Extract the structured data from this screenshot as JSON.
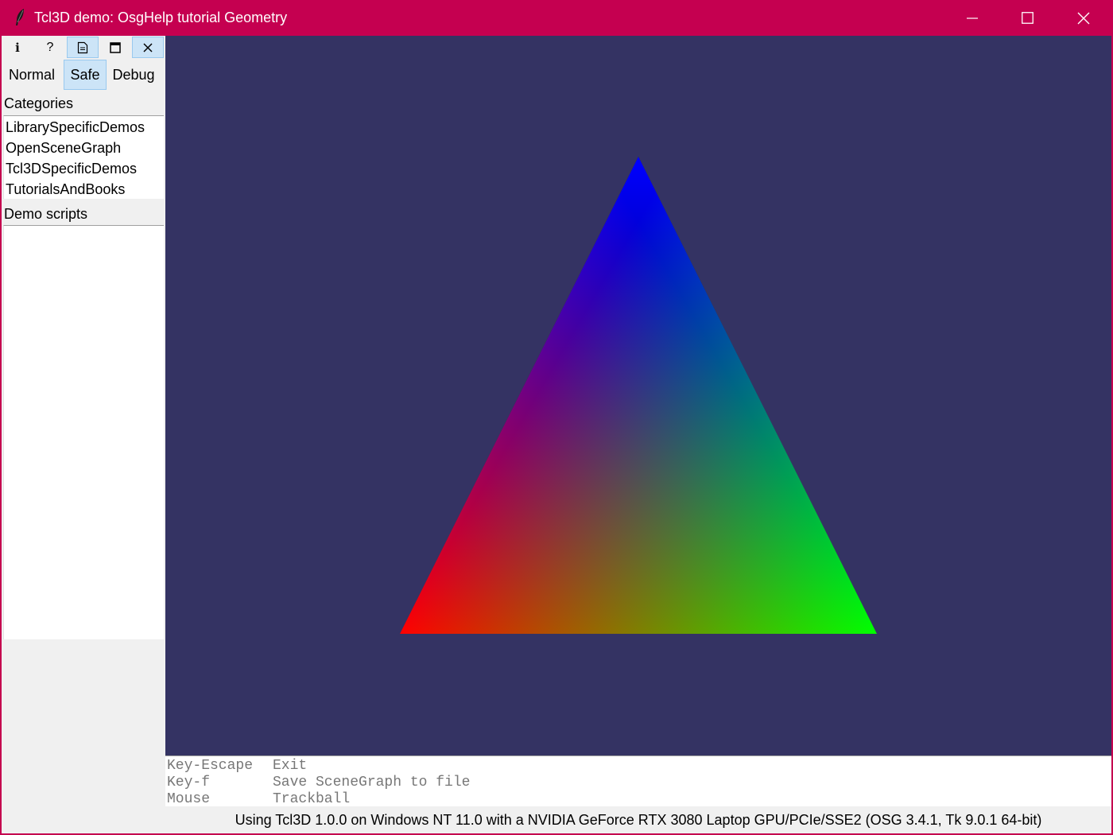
{
  "window": {
    "title": "Tcl3D demo: OsgHelp tutorial Geometry",
    "app_icon": "feather-icon",
    "controls": [
      "minimize-icon",
      "maximize-icon",
      "close-icon"
    ],
    "titlebar_color": "#c50050"
  },
  "toolbar": {
    "buttons": [
      {
        "icon": "info-icon",
        "glyph": "i"
      },
      {
        "icon": "help-icon",
        "glyph": "?"
      },
      {
        "icon": "document-icon",
        "glyph": ""
      },
      {
        "icon": "window-icon",
        "glyph": ""
      },
      {
        "icon": "close-icon",
        "glyph": ""
      }
    ]
  },
  "modes": {
    "items": [
      "Normal",
      "Safe",
      "Debug"
    ],
    "selected": "Safe"
  },
  "sidebar": {
    "categories_label": "Categories",
    "categories": [
      "LibrarySpecificDemos",
      "OpenSceneGraph",
      "Tcl3DSpecificDemos",
      "TutorialsAndBooks"
    ],
    "demo_scripts_label": "Demo scripts",
    "demo_scripts": []
  },
  "viewport": {
    "background": "#343363",
    "triangle": {
      "vertex_colors": {
        "top": "#0000ff",
        "bottom_left": "#ff0000",
        "bottom_right": "#00ff00"
      }
    }
  },
  "help": [
    {
      "key": "Key-Escape",
      "action": "Exit"
    },
    {
      "key": "Key-f",
      "action": "Save SceneGraph to file"
    },
    {
      "key": "Mouse",
      "action": "Trackball"
    }
  ],
  "status": "Using Tcl3D 1.0.0 on Windows NT 11.0 with a NVIDIA GeForce RTX 3080 Laptop GPU/PCIe/SSE2 (OSG 3.4.1, Tk 9.0.1 64-bit)"
}
